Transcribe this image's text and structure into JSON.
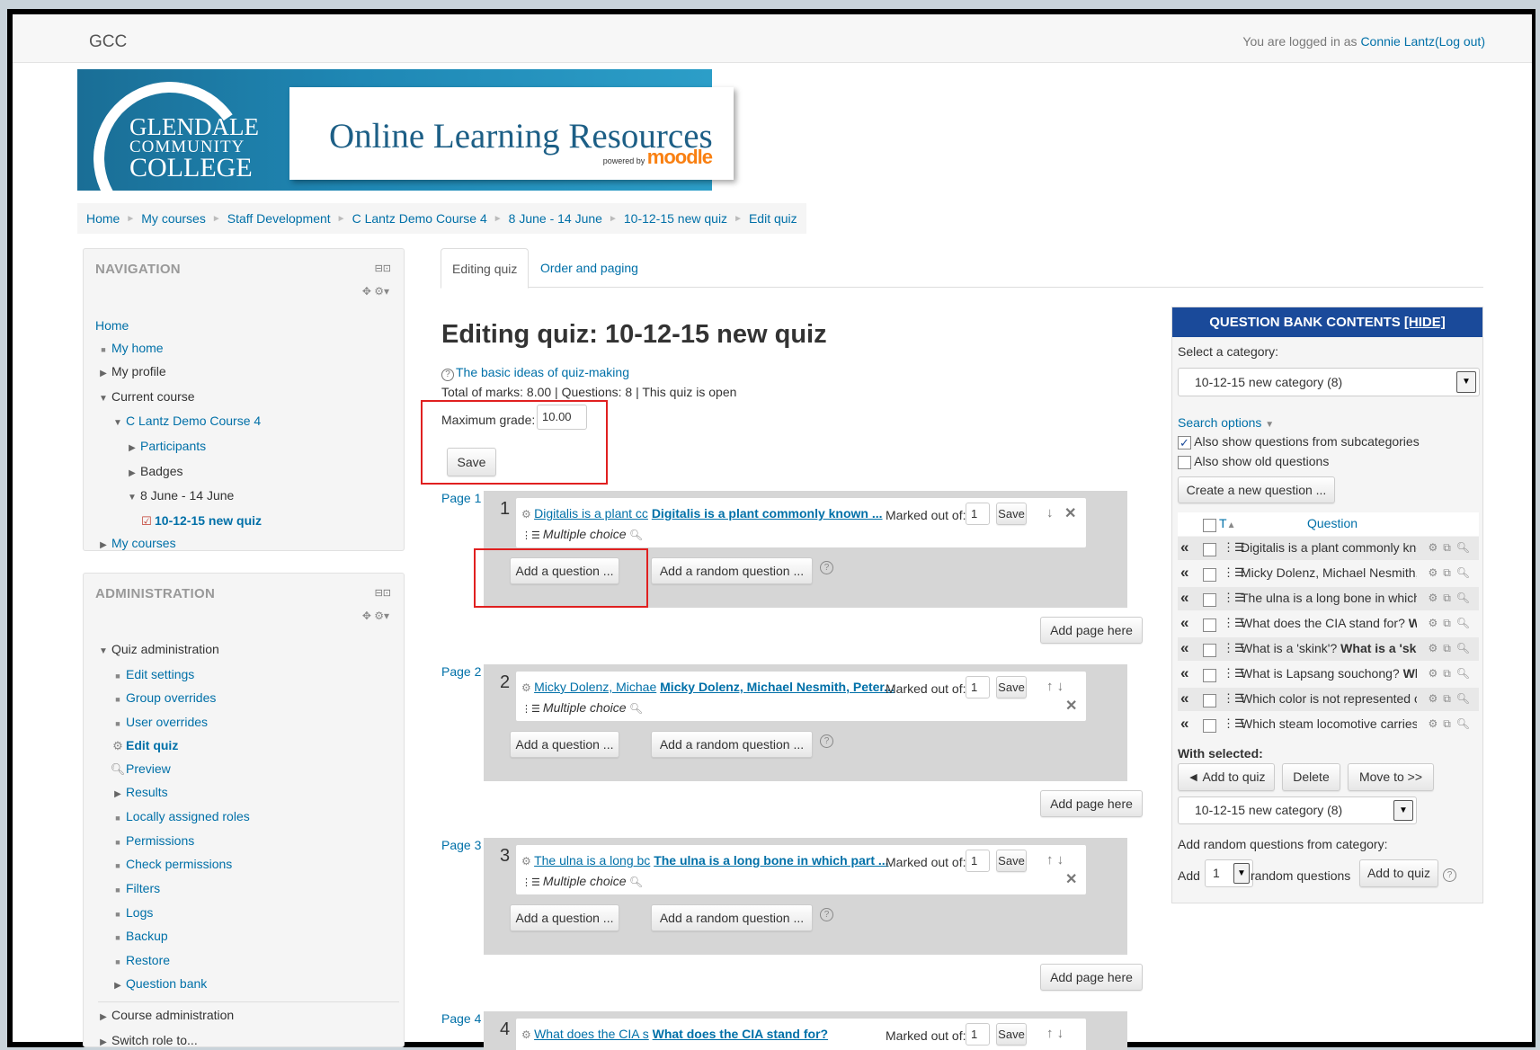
{
  "header": {
    "site_name": "GCC",
    "logged_in_prefix": "You are logged in as ",
    "user_name": "Connie Lantz",
    "logout": "(Log out)"
  },
  "banner": {
    "college_line1": "GLENDALE",
    "college_line2": "COMMUNITY",
    "college_line3": "COLLEGE",
    "title": "Online Learning Resources",
    "powered_by": "powered by",
    "moodle": "moodle"
  },
  "breadcrumb": [
    "Home",
    "My courses",
    "Staff Development",
    "C Lantz Demo Course 4",
    "8 June - 14 June",
    "10-12-15 new quiz",
    "Edit quiz"
  ],
  "navigation": {
    "title": "NAVIGATION",
    "items": [
      {
        "label": "Home",
        "icon": "",
        "level": 0,
        "link": true,
        "bold": false
      },
      {
        "label": "My home",
        "icon": "bullet",
        "level": 0,
        "link": true,
        "bold": false
      },
      {
        "label": "My profile",
        "icon": "collapsed",
        "level": 0,
        "link": false,
        "bold": false
      },
      {
        "label": "Current course",
        "icon": "expanded",
        "level": 0,
        "link": false,
        "bold": false
      },
      {
        "label": "C Lantz Demo Course 4",
        "icon": "expanded",
        "level": 1,
        "link": true,
        "bold": false
      },
      {
        "label": "Participants",
        "icon": "collapsed",
        "level": 2,
        "link": true,
        "bold": false
      },
      {
        "label": "Badges",
        "icon": "collapsed",
        "level": 2,
        "link": false,
        "bold": false
      },
      {
        "label": "8 June - 14 June",
        "icon": "expanded",
        "level": 2,
        "link": false,
        "bold": false
      },
      {
        "label": "10-12-15 new quiz",
        "icon": "quiz",
        "level": 3,
        "link": true,
        "bold": true
      },
      {
        "label": "My courses",
        "icon": "collapsed",
        "level": 0,
        "link": true,
        "bold": false
      }
    ]
  },
  "administration": {
    "title": "ADMINISTRATION",
    "items": [
      {
        "label": "Quiz administration",
        "icon": "expanded",
        "level": 0,
        "link": false,
        "bold": false
      },
      {
        "label": "Edit settings",
        "icon": "bullet",
        "level": 1,
        "link": true,
        "bold": false
      },
      {
        "label": "Group overrides",
        "icon": "bullet",
        "level": 1,
        "link": true,
        "bold": false
      },
      {
        "label": "User overrides",
        "icon": "bullet",
        "level": 1,
        "link": true,
        "bold": false
      },
      {
        "label": "Edit quiz",
        "icon": "gear",
        "level": 1,
        "link": true,
        "bold": true
      },
      {
        "label": "Preview",
        "icon": "search",
        "level": 1,
        "link": true,
        "bold": false
      },
      {
        "label": "Results",
        "icon": "collapsed",
        "level": 1,
        "link": true,
        "bold": false
      },
      {
        "label": "Locally assigned roles",
        "icon": "bullet",
        "level": 1,
        "link": true,
        "bold": false
      },
      {
        "label": "Permissions",
        "icon": "bullet",
        "level": 1,
        "link": true,
        "bold": false
      },
      {
        "label": "Check permissions",
        "icon": "bullet",
        "level": 1,
        "link": true,
        "bold": false
      },
      {
        "label": "Filters",
        "icon": "bullet",
        "level": 1,
        "link": true,
        "bold": false
      },
      {
        "label": "Logs",
        "icon": "bullet",
        "level": 1,
        "link": true,
        "bold": false
      },
      {
        "label": "Backup",
        "icon": "bullet",
        "level": 1,
        "link": true,
        "bold": false
      },
      {
        "label": "Restore",
        "icon": "bullet",
        "level": 1,
        "link": true,
        "bold": false
      },
      {
        "label": "Question bank",
        "icon": "collapsed",
        "level": 1,
        "link": true,
        "bold": false
      },
      {
        "label": "Course administration",
        "icon": "collapsed",
        "level": 0,
        "link": false,
        "bold": false
      },
      {
        "label": "Switch role to...",
        "icon": "collapsed",
        "level": 0,
        "link": false,
        "bold": false
      }
    ]
  },
  "tabs": {
    "active": "Editing quiz",
    "other": "Order and paging"
  },
  "main": {
    "title": "Editing quiz: 10-12-15 new quiz",
    "help_link": "The basic ideas of quiz-making",
    "totals": "Total of marks: 8.00 | Questions: 8 | This quiz is open",
    "max_grade_label": "Maximum grade:",
    "max_grade_value": "10.00",
    "save_label": "Save",
    "add_question": "Add a question ...",
    "add_random": "Add a random question ...",
    "add_page_here": "Add page here",
    "marked_out_of": "Marked out of:",
    "mark_value": "1",
    "qtype": "Multiple choice"
  },
  "pages": [
    {
      "page": "Page 1",
      "num": "1",
      "name": "Digitalis is a plant cc",
      "text": "Digitalis is a plant commonly known ..."
    },
    {
      "page": "Page 2",
      "num": "2",
      "name": "Micky Dolenz, Michae",
      "text": "Micky Dolenz, Michael Nesmith, Peter..."
    },
    {
      "page": "Page 3",
      "num": "3",
      "name": "The ulna is a long bc",
      "text": "The ulna is a long bone in which part ..."
    },
    {
      "page": "Page 4",
      "num": "4",
      "name": "What does the CIA s",
      "text": "What does the CIA stand for?"
    }
  ],
  "question_bank": {
    "title": "QUESTION BANK CONTENTS",
    "hide": "[HIDE]",
    "select_category_label": "Select a category:",
    "category": "10-12-15 new category (8)",
    "search_options": "Search options",
    "opt_subcategories": "Also show questions from subcategories",
    "opt_old": "Also show old questions",
    "create_new": "Create a new question ...",
    "col_t": "T",
    "col_question": "Question",
    "rows": [
      {
        "name": "Digitalis is a plant commonly know",
        "text": ""
      },
      {
        "name": "Micky Dolenz, Michael Nesmith, Pe",
        "text": ""
      },
      {
        "name": "The ulna is a long bone in which p",
        "text": ""
      },
      {
        "name": "What does the CIA stand for?",
        "text": "What"
      },
      {
        "name": "What is a 'skink'?",
        "text": "What is a 'skink"
      },
      {
        "name": "What is Lapsang souchong?",
        "text": "What"
      },
      {
        "name": "Which color is not represented on",
        "text": ""
      },
      {
        "name": "Which steam locomotive carries th",
        "text": ""
      }
    ],
    "with_selected": "With selected:",
    "add_to_quiz": "◄ Add to quiz",
    "delete": "Delete",
    "move_to": "Move to >>",
    "category2": "10-12-15 new category (8)",
    "add_random_label": "Add random questions from category:",
    "add_word": "Add",
    "random_count": "1",
    "random_questions": "random questions",
    "add_to_quiz2": "Add to quiz"
  }
}
